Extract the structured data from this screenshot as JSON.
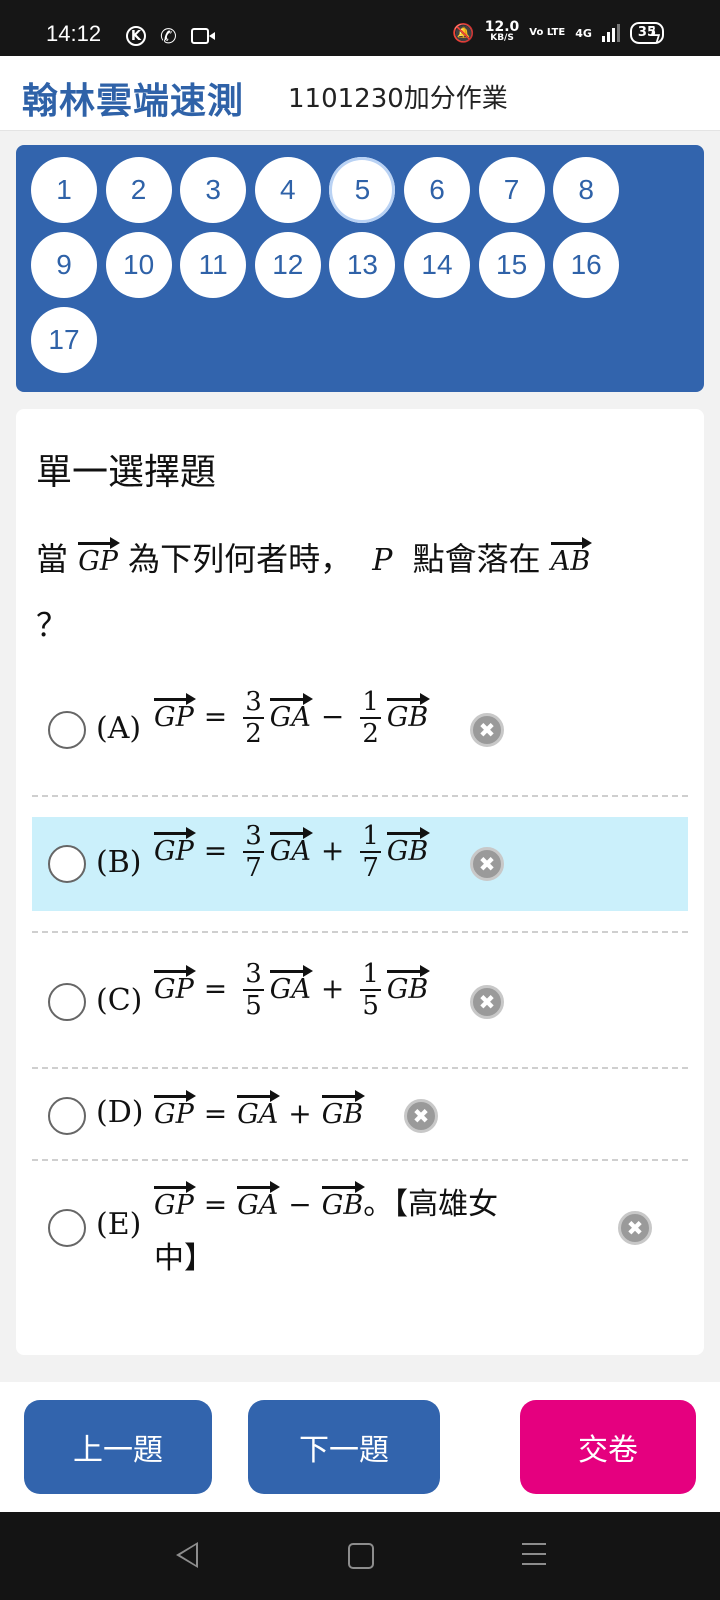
{
  "status_bar": {
    "time": "14:12",
    "speed_value": "12.0",
    "speed_unit": "KB/S",
    "volte": "Vo LTE",
    "network": "4G",
    "battery": "35"
  },
  "header": {
    "brand": "翰林雲端速測",
    "title": "1101230加分作業"
  },
  "question_nav": {
    "numbers": [
      "1",
      "2",
      "3",
      "4",
      "5",
      "6",
      "7",
      "8",
      "9",
      "10",
      "11",
      "12",
      "13",
      "14",
      "15",
      "16",
      "17"
    ],
    "current": "5"
  },
  "question": {
    "type": "單一選擇題",
    "text_1": "當",
    "vec_gp": "GP",
    "text_2": "為下列何者時，",
    "point": "P",
    "text_3": "點會落在",
    "line_ab": "AB",
    "text_4": "？"
  },
  "options": [
    {
      "label": "(A)",
      "lhs": "GP",
      "eq": "=",
      "c1_num": "3",
      "c1_den": "2",
      "v1": "GA",
      "op": "−",
      "c2_num": "1",
      "c2_den": "2",
      "v2": "GB"
    },
    {
      "label": "(B)",
      "lhs": "GP",
      "eq": "=",
      "c1_num": "3",
      "c1_den": "7",
      "v1": "GA",
      "op": "+",
      "c2_num": "1",
      "c2_den": "7",
      "v2": "GB"
    },
    {
      "label": "(C)",
      "lhs": "GP",
      "eq": "=",
      "c1_num": "3",
      "c1_den": "5",
      "v1": "GA",
      "op": "+",
      "c2_num": "1",
      "c2_den": "5",
      "v2": "GB"
    },
    {
      "label": "(D)",
      "lhs": "GP",
      "eq": "=",
      "v1": "GA",
      "op": "+",
      "v2": "GB"
    },
    {
      "label": "(E)",
      "lhs": "GP",
      "eq": "=",
      "v1": "GA",
      "op": "−",
      "v2": "GB",
      "suffix": "。【高雄女",
      "suffix2": "中】"
    }
  ],
  "highlight_color": "#cbf0fb",
  "buttons": {
    "prev": "上一題",
    "next": "下一題",
    "submit": "交卷"
  },
  "colors": {
    "primary": "#3264ad",
    "submit": "#e5007f"
  }
}
